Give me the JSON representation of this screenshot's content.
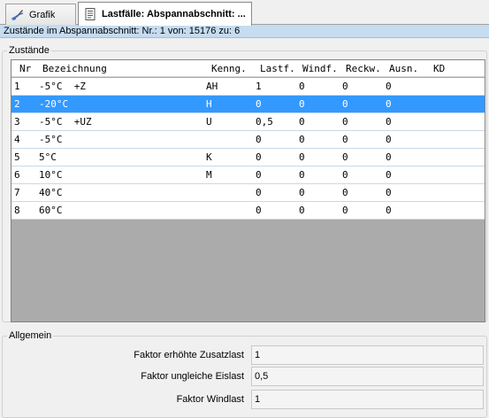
{
  "tabs": [
    {
      "label": "Grafik",
      "icon": "brush-icon"
    },
    {
      "label": "Lastfälle: Abspannabschnitt: ...",
      "icon": "document-icon"
    }
  ],
  "status_text": "Zustände im Abspannabschnitt: Nr.: 1 von: 15176 zu: 6",
  "zustaende": {
    "title": "Zustände",
    "columns": [
      "Nr",
      "Bezeichnung",
      "Kenng.",
      "Lastf.",
      "Windf.",
      "Reckw.",
      "Ausn.",
      "KD"
    ],
    "rows": [
      {
        "nr": "1",
        "bez": "-5°C  +Z",
        "ken": "AH",
        "last": "1",
        "wind": "0",
        "reck": "0",
        "ausn": "0",
        "kd": ""
      },
      {
        "nr": "2",
        "bez": "-20°C",
        "ken": "H",
        "last": "0",
        "wind": "0",
        "reck": "0",
        "ausn": "0",
        "kd": ""
      },
      {
        "nr": "3",
        "bez": "-5°C  +UZ",
        "ken": "U",
        "last": "0,5",
        "wind": "0",
        "reck": "0",
        "ausn": "0",
        "kd": ""
      },
      {
        "nr": "4",
        "bez": "-5°C",
        "ken": "",
        "last": "0",
        "wind": "0",
        "reck": "0",
        "ausn": "0",
        "kd": ""
      },
      {
        "nr": "5",
        "bez": "5°C",
        "ken": "K",
        "last": "0",
        "wind": "0",
        "reck": "0",
        "ausn": "0",
        "kd": ""
      },
      {
        "nr": "6",
        "bez": "10°C",
        "ken": "M",
        "last": "0",
        "wind": "0",
        "reck": "0",
        "ausn": "0",
        "kd": ""
      },
      {
        "nr": "7",
        "bez": "40°C",
        "ken": "",
        "last": "0",
        "wind": "0",
        "reck": "0",
        "ausn": "0",
        "kd": ""
      },
      {
        "nr": "8",
        "bez": "60°C",
        "ken": "",
        "last": "0",
        "wind": "0",
        "reck": "0",
        "ausn": "0",
        "kd": ""
      }
    ],
    "selected_row": 1
  },
  "allgemein": {
    "title": "Allgemein",
    "fields": [
      {
        "label": "Faktor erhöhte Zusatzlast",
        "value": "1"
      },
      {
        "label": "Faktor ungleiche Eislast",
        "value": "0,5"
      },
      {
        "label": "Faktor Windlast",
        "value": "1"
      }
    ]
  },
  "colors": {
    "selection": "#3399ff",
    "status_bar": "#c5dcf1",
    "grid_empty": "#ababab"
  }
}
